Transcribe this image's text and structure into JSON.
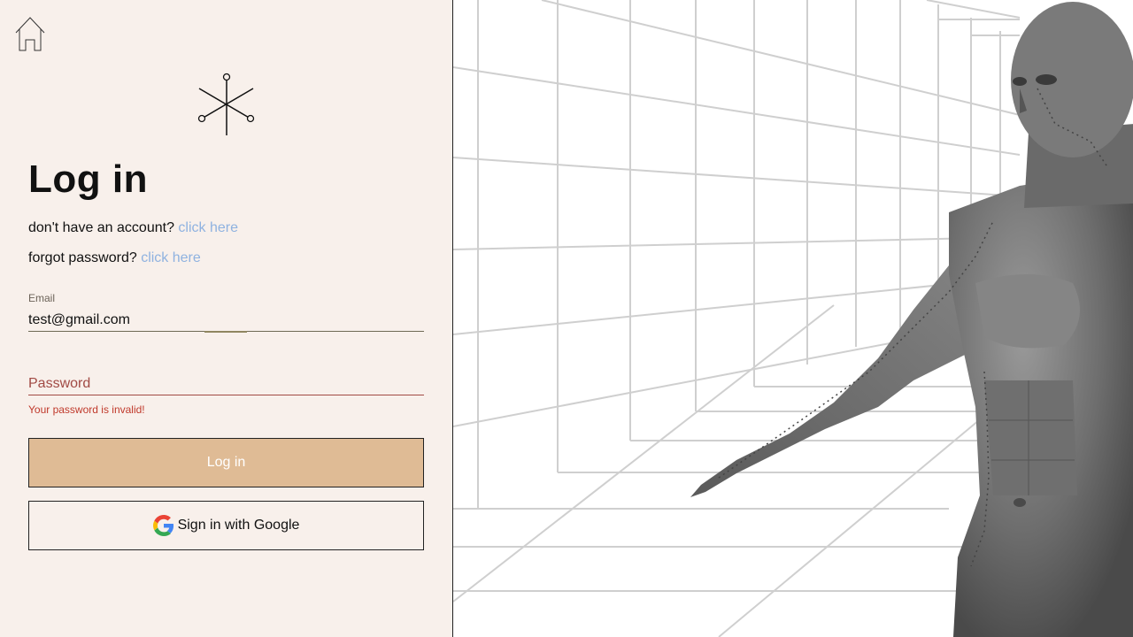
{
  "page": {
    "title": "Log in",
    "signup_prompt": "don't have an account?",
    "signup_link": "click here",
    "forgot_prompt": "forgot password?",
    "forgot_link": "click here"
  },
  "form": {
    "email_label": "Email",
    "email_value": "test@gmail.com",
    "password_placeholder": "Password",
    "password_error": "Your password is invalid!",
    "login_label": "Log in",
    "google_label": "Sign in with Google"
  },
  "icons": {
    "home": "home-icon",
    "logo": "acupuncture-needles-logo",
    "google": "google-icon"
  },
  "colors": {
    "background": "#f8f0eb",
    "link": "#8fb2e0",
    "error": "#c0392b",
    "login_button": "#dfbb95"
  }
}
